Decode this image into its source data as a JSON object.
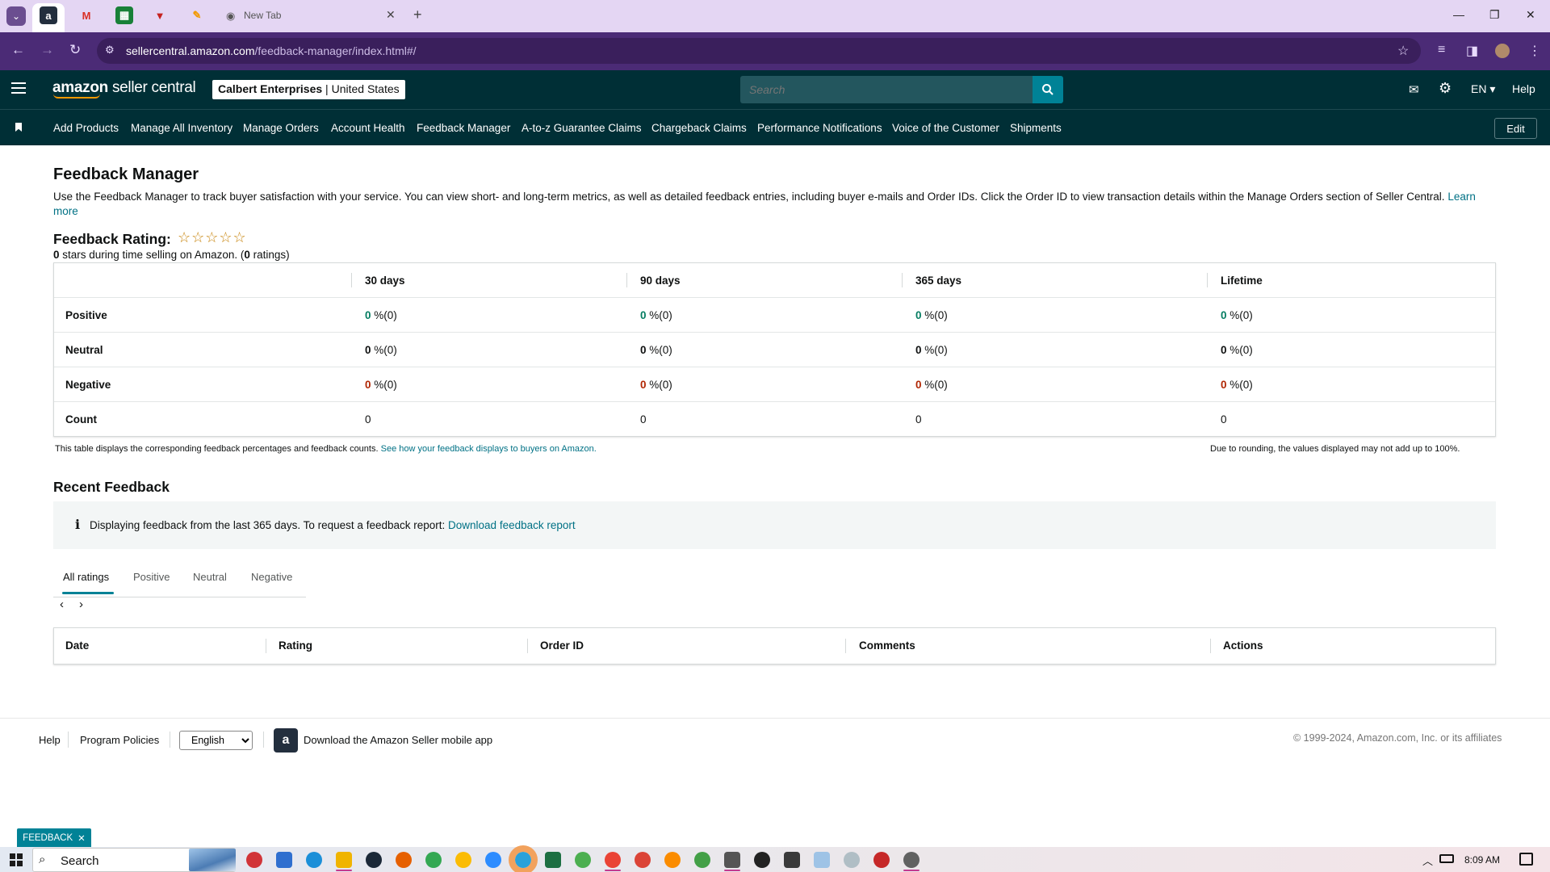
{
  "browser": {
    "tabs": [
      {
        "name": "amazon",
        "icon": "amazon-icon"
      },
      {
        "name": "gmail",
        "icon": "gmail-icon"
      },
      {
        "name": "sheets",
        "icon": "sheets-icon"
      },
      {
        "name": "app",
        "icon": "shield-icon"
      },
      {
        "name": "app2",
        "icon": "pen-icon"
      }
    ],
    "new_tab_title": "New Tab",
    "url_host": "sellercentral.amazon.com",
    "url_path": "/feedback-manager/index.html#/"
  },
  "header": {
    "logo_brand": "amazon",
    "logo_product": "seller central",
    "account_name": "Calbert Enterprises",
    "account_sep": " | ",
    "marketplace": "United States",
    "search_placeholder": "Search",
    "language": "EN",
    "help": "Help"
  },
  "nav": {
    "links": [
      "Add Products",
      "Manage All Inventory",
      "Manage Orders",
      "Account Health",
      "Feedback Manager",
      "A-to-z Guarantee Claims",
      "Chargeback Claims",
      "Performance Notifications",
      "Voice of the Customer",
      "Shipments"
    ],
    "edit": "Edit"
  },
  "page": {
    "title": "Feedback Manager",
    "intro": "Use the Feedback Manager to track buyer satisfaction with your service. You can view short- and long-term metrics, as well as detailed feedback entries, including buyer e-mails and Order IDs. Click the Order ID to view transaction details within the Manage Orders section of Seller Central.",
    "learn_more": "Learn more",
    "rating_title": "Feedback Rating:",
    "stars": "☆☆☆☆☆",
    "rating_stars_count": "0",
    "rating_mid": " stars during time selling on Amazon. (",
    "rating_count": "0",
    "rating_end": " ratings)"
  },
  "metrics": {
    "columns": [
      "30 days",
      "90 days",
      "365 days",
      "Lifetime"
    ],
    "rows": [
      {
        "label": "Positive",
        "values": [
          [
            "0",
            " %(0)"
          ],
          [
            "0",
            " %(0)"
          ],
          [
            "0",
            " %(0)"
          ],
          [
            "0",
            " %(0)"
          ]
        ]
      },
      {
        "label": "Neutral",
        "values": [
          [
            "0",
            " %(0)"
          ],
          [
            "0",
            " %(0)"
          ],
          [
            "0",
            " %(0)"
          ],
          [
            "0",
            " %(0)"
          ]
        ]
      },
      {
        "label": "Negative",
        "values": [
          [
            "0",
            " %(0)"
          ],
          [
            "0",
            " %(0)"
          ],
          [
            "0",
            " %(0)"
          ],
          [
            "0",
            " %(0)"
          ]
        ]
      },
      {
        "label": "Count",
        "values": [
          [
            "",
            "0"
          ],
          [
            "",
            "0"
          ],
          [
            "",
            "0"
          ],
          [
            "",
            "0"
          ]
        ]
      }
    ],
    "note": "This table displays the corresponding feedback percentages and feedback counts.",
    "note_link": "See how your feedback displays to buyers on Amazon.",
    "rounding_note": "Due to rounding, the values displayed may not add up to 100%."
  },
  "recent": {
    "title": "Recent Feedback",
    "info": "Displaying feedback from the last 365 days. To request a feedback report:",
    "info_link": "Download feedback report",
    "tabs": [
      "All ratings",
      "Positive",
      "Neutral",
      "Negative"
    ],
    "columns": [
      "Date",
      "Rating",
      "Order ID",
      "Comments",
      "Actions"
    ]
  },
  "footer": {
    "help": "Help",
    "policies": "Program Policies",
    "language": "English",
    "app_text": "Download the Amazon Seller mobile app",
    "copyright": "© 1999-2024, Amazon.com, Inc. or its affiliates"
  },
  "feedback_tab": "FEEDBACK",
  "taskbar": {
    "search": "Search",
    "time": "8:09 AM"
  },
  "colors": {
    "header_bg": "#002f36",
    "accent": "#008296",
    "link": "#007185",
    "positive": "#067d62",
    "negative": "#b12704"
  }
}
